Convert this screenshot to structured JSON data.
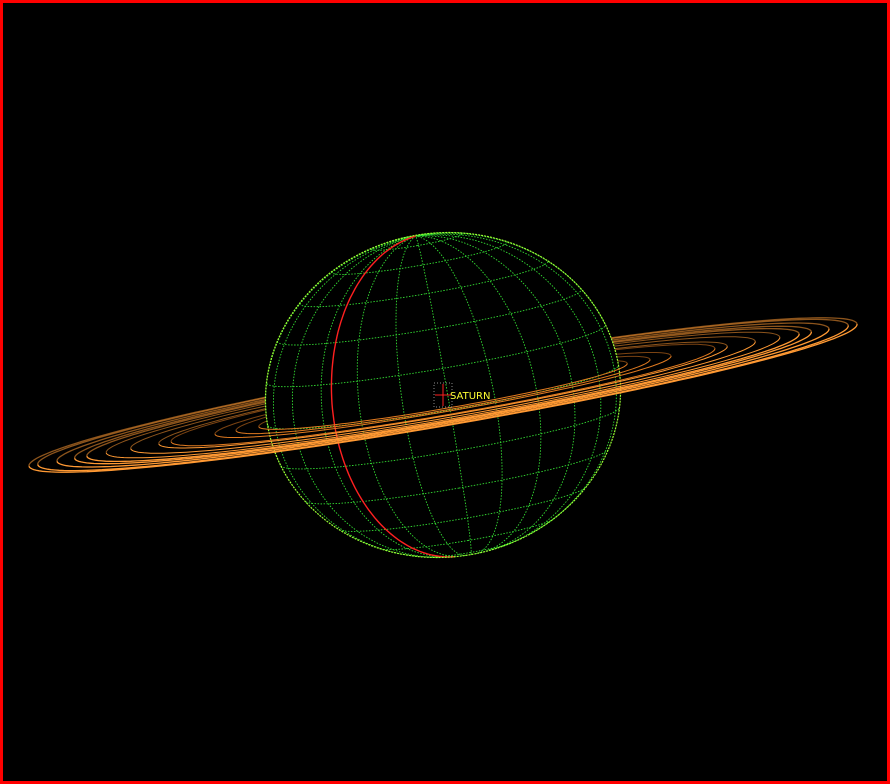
{
  "scene": {
    "target_label": "SATURN",
    "colors": {
      "frame": "#ff0000",
      "background": "#000000",
      "grid": "#33dd33",
      "grid_limb": "#99ff33",
      "rings": "#ff9933",
      "rings_inner": "#e07a20",
      "meridian_highlight": "#ff2020",
      "label": "#ffff33",
      "marker": "#ff2020",
      "marker_box": "#c0c0c0"
    }
  }
}
